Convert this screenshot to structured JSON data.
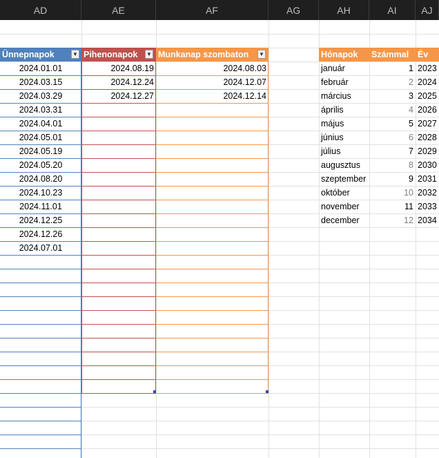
{
  "columns": [
    "AD",
    "AE",
    "AF",
    "AG",
    "AH",
    "AI",
    "AJ"
  ],
  "table_holidays": {
    "header": "Ünnepnapok",
    "filter_icon": "sort-filter-dropdown",
    "values": [
      "2024.01.01",
      "2024.03.15",
      "2024.03.29",
      "2024.03.31",
      "2024.04.01",
      "2024.05.01",
      "2024.05.19",
      "2024.05.20",
      "2024.08.20",
      "2024.10.23",
      "2024.11.01",
      "2024.12.25",
      "2024.12.26",
      "2024.07.01"
    ]
  },
  "table_restdays": {
    "header": "Pihenonapok",
    "filter_icon": "dropdown",
    "values": [
      "2024.08.19",
      "2024.12.24",
      "2024.12.27"
    ]
  },
  "table_worksaturdays": {
    "header": "Munkanap szombaton",
    "filter_icon": "dropdown",
    "values": [
      "2024.08.03",
      "2024.12.07",
      "2024.12.14"
    ]
  },
  "table_months": {
    "headers": [
      "Hónapok",
      "Számmal",
      "Év"
    ],
    "months": [
      "január",
      "február",
      "március",
      "április",
      "május",
      "június",
      "július",
      "augusztus",
      "szeptember",
      "október",
      "november",
      "december"
    ],
    "numbers": [
      "1",
      "2",
      "3",
      "4",
      "5",
      "6",
      "7",
      "8",
      "9",
      "10",
      "11",
      "12"
    ],
    "years": [
      "2023",
      "2024",
      "2025",
      "2026",
      "2027",
      "2028",
      "2029",
      "2030",
      "2031",
      "2032",
      "2033",
      "2034"
    ]
  },
  "colors": {
    "holidays": "#4f81bd",
    "restdays": "#c0504d",
    "worksaturdays": "#f79646",
    "months": "#f79646"
  }
}
